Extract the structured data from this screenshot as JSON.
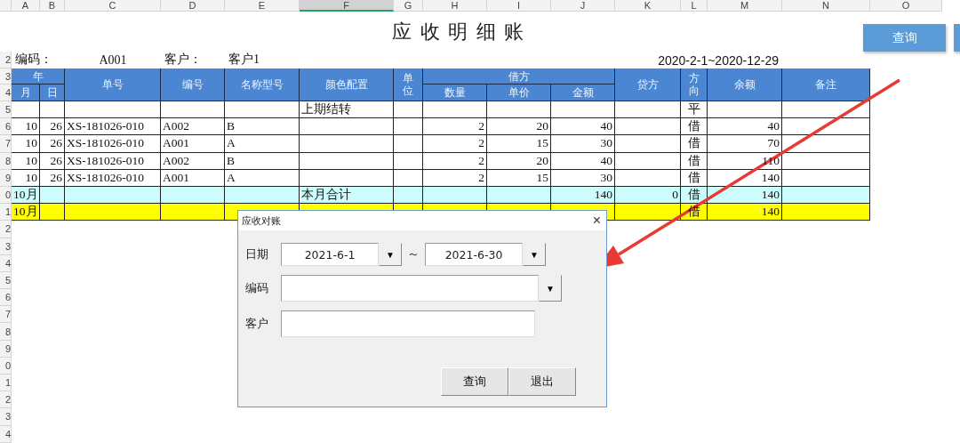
{
  "column_letters": [
    {
      "label": "A",
      "selected": false
    },
    {
      "label": "B",
      "selected": false
    },
    {
      "label": "C",
      "selected": false
    },
    {
      "label": "D",
      "selected": false
    },
    {
      "label": "E",
      "selected": false
    },
    {
      "label": "F",
      "selected": true
    },
    {
      "label": "G",
      "selected": false
    },
    {
      "label": "H",
      "selected": false
    },
    {
      "label": "I",
      "selected": false
    },
    {
      "label": "J",
      "selected": false
    },
    {
      "label": "K",
      "selected": false
    },
    {
      "label": "L",
      "selected": false
    },
    {
      "label": "M",
      "selected": false
    },
    {
      "label": "N",
      "selected": false
    },
    {
      "label": "O",
      "selected": false
    }
  ],
  "row_numbers": [
    "2",
    "3",
    "4",
    "5",
    "6",
    "7",
    "8",
    "9",
    "0",
    "1",
    "2",
    "3",
    "4",
    "5",
    "6",
    "7",
    "8",
    "9",
    "0",
    "1",
    "2",
    "3",
    "4"
  ],
  "title": "应 收 明 细 账",
  "info": {
    "code_label": "编码：",
    "code": "A001",
    "customer_label": "客户：",
    "customer": "客户1",
    "date_range": "2020-2-1~2020-12-29"
  },
  "header": {
    "year": "年",
    "month": "月",
    "day": "日",
    "doc_no": "单号",
    "code": "编号",
    "name": "名称型号",
    "color_config": "颜色配置",
    "unit": "单位",
    "debit": "借方",
    "qty": "数量",
    "price": "单价",
    "amount": "金额",
    "credit": "贷方",
    "direction": "方向",
    "balance": "余额",
    "note": "备注"
  },
  "rows": [
    {
      "kind": "normal",
      "color_config": "上期结转",
      "direction": "平"
    },
    {
      "kind": "normal",
      "month": "10",
      "day": "26",
      "doc_no": "XS-181026-010",
      "code": "A002",
      "name": "B",
      "qty": "2",
      "price": "20",
      "amount": "40",
      "direction": "借",
      "balance": "40"
    },
    {
      "kind": "normal",
      "month": "10",
      "day": "26",
      "doc_no": "XS-181026-010",
      "code": "A001",
      "name": "A",
      "qty": "2",
      "price": "15",
      "amount": "30",
      "direction": "借",
      "balance": "70"
    },
    {
      "kind": "normal",
      "month": "10",
      "day": "26",
      "doc_no": "XS-181026-010",
      "code": "A002",
      "name": "B",
      "qty": "2",
      "price": "20",
      "amount": "40",
      "direction": "借",
      "balance": "110"
    },
    {
      "kind": "normal",
      "month": "10",
      "day": "26",
      "doc_no": "XS-181026-010",
      "code": "A001",
      "name": "A",
      "qty": "2",
      "price": "15",
      "amount": "30",
      "direction": "借",
      "balance": "140"
    },
    {
      "kind": "subtotal",
      "month": "10月",
      "color_config": "本月合计",
      "amount": "140",
      "credit": "0",
      "direction": "借",
      "balance": "140"
    },
    {
      "kind": "cumulative",
      "month": "10月",
      "direction": "借",
      "balance": "140"
    }
  ],
  "sheet_buttons": [
    {
      "kind": "button",
      "label": "查询"
    },
    {
      "kind": "button"
    }
  ],
  "dialog": {
    "title": "应收对账",
    "close": "×",
    "date_label": "日期",
    "date_from": "2021-6-1",
    "date_to": "2021-6-30",
    "tilde": "～",
    "dropdown_glyph": "▼",
    "code_label": "编码",
    "customer_label": "客户",
    "buttons": [
      "查询",
      "退出"
    ]
  }
}
